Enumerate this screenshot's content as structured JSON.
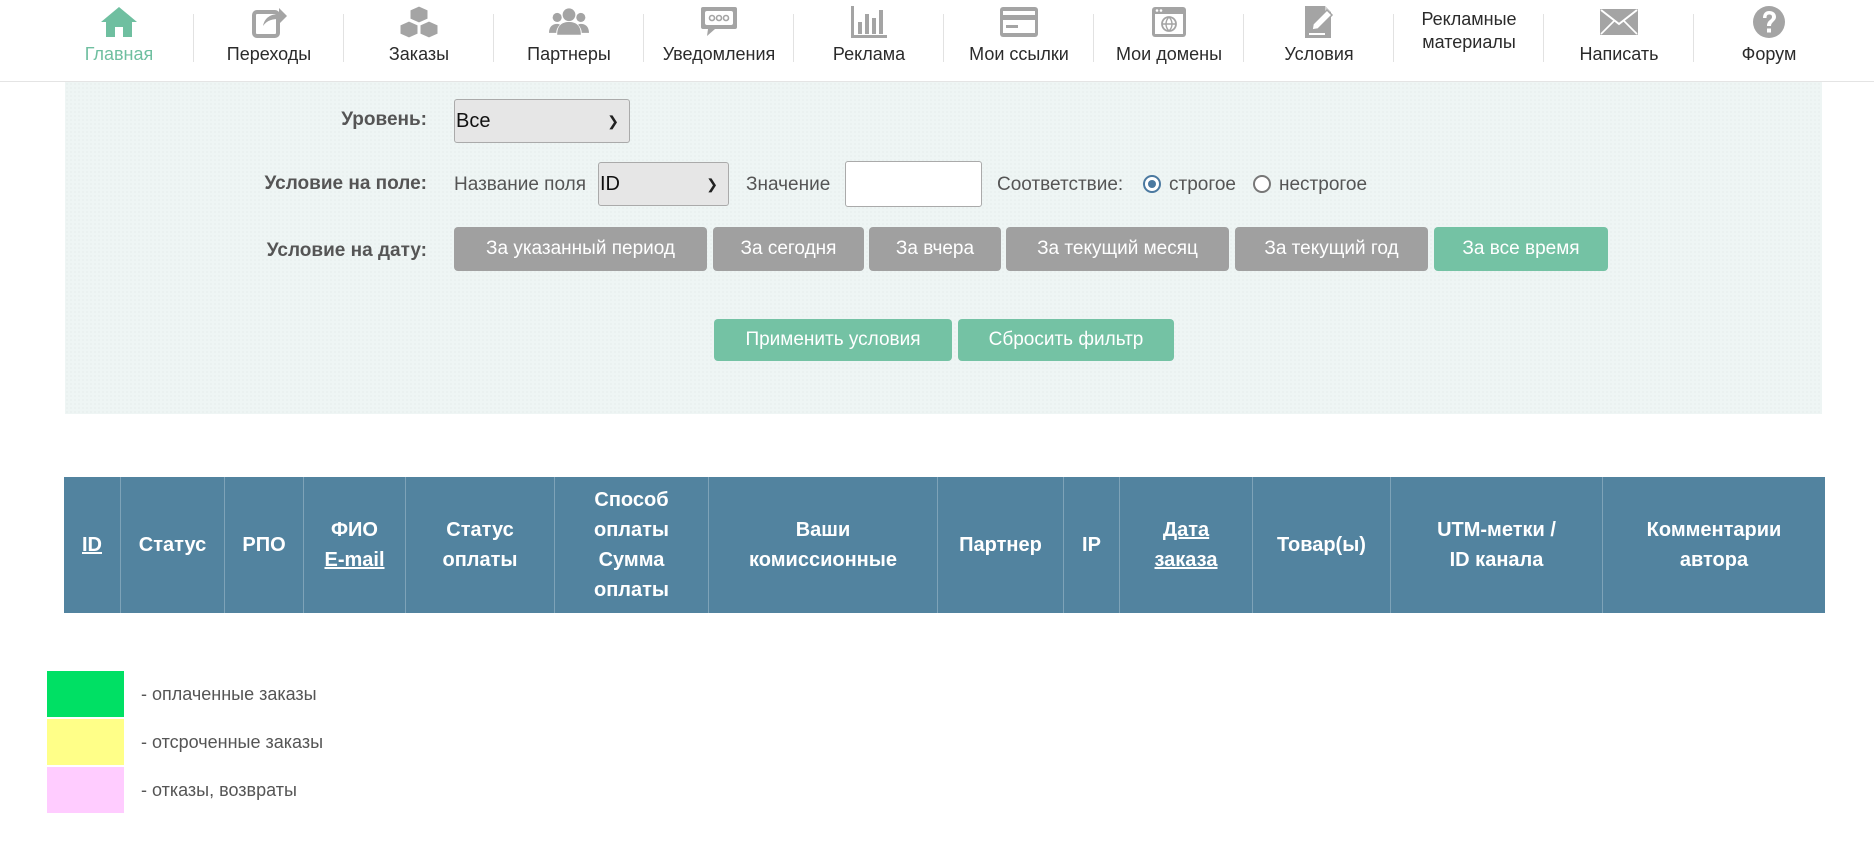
{
  "nav": [
    {
      "label": "Главная",
      "icon": "home-icon",
      "active": true
    },
    {
      "label": "Переходы",
      "icon": "share-icon"
    },
    {
      "label": "Заказы",
      "icon": "boxes-icon"
    },
    {
      "label": "Партнеры",
      "icon": "users-icon"
    },
    {
      "label": "Уведомления",
      "icon": "chat-bubble-icon"
    },
    {
      "label": "Реклама",
      "icon": "bar-chart-icon"
    },
    {
      "label": "Мои ссылки",
      "icon": "card-icon"
    },
    {
      "label": "Мои домены",
      "icon": "browser-window-icon"
    },
    {
      "label": "Условия",
      "icon": "document-edit-icon"
    },
    {
      "label": "Рекламные материалы",
      "icon": "",
      "line1": "Рекламные",
      "line2": "материалы"
    },
    {
      "label": "Написать",
      "icon": "envelope-icon"
    },
    {
      "label": "Форум",
      "icon": "question-icon"
    }
  ],
  "colors": {
    "accent": "#6fbfa0",
    "table_header": "#52839f",
    "button_gray": "#a0a0a0",
    "button_green": "#74c2a4"
  },
  "filter": {
    "level_label": "Уровень:",
    "level_value": "Все",
    "field_condition_label": "Условие на поле:",
    "field_name_label": "Название поля",
    "field_name_value": "ID",
    "value_label": "Значение",
    "value_input": "",
    "match_label": "Соответствие:",
    "match_strict": "строгое",
    "match_loose": "нестрогое",
    "match_selected": "strict",
    "date_condition_label": "Условие на дату:",
    "date_buttons": [
      "За указанный период",
      "За сегодня",
      "За вчера",
      "За текущий месяц",
      "За текущий год",
      "За все время"
    ],
    "date_active": "За все время",
    "apply_label": "Применить условия",
    "reset_label": "Сбросить фильтр"
  },
  "table": {
    "columns": [
      {
        "lines": [
          "ID"
        ],
        "sortable": true
      },
      {
        "lines": [
          "Статус"
        ]
      },
      {
        "lines": [
          "РПО"
        ]
      },
      {
        "lines": [
          "ФИО",
          "E-mail"
        ],
        "sortable_line": 1
      },
      {
        "lines": [
          "Статус",
          "оплаты"
        ]
      },
      {
        "lines": [
          "Способ",
          "оплаты",
          "Сумма",
          "оплаты"
        ]
      },
      {
        "lines": [
          "Ваши",
          "комиссионные"
        ]
      },
      {
        "lines": [
          "Партнер"
        ]
      },
      {
        "lines": [
          "IP"
        ]
      },
      {
        "lines": [
          "Дата",
          "заказа"
        ],
        "sortable": true
      },
      {
        "lines": [
          "Товар(ы)"
        ]
      },
      {
        "lines": [
          "UTM-метки /",
          "ID канала"
        ]
      },
      {
        "lines": [
          "Комментарии",
          "автора"
        ]
      }
    ]
  },
  "legend": [
    {
      "color": "#00e064",
      "text": "- оплаченные заказы"
    },
    {
      "color": "#ffff88",
      "text": "- отсроченные заказы"
    },
    {
      "color": "#ffccff",
      "text": "- отказы, возвраты"
    }
  ]
}
